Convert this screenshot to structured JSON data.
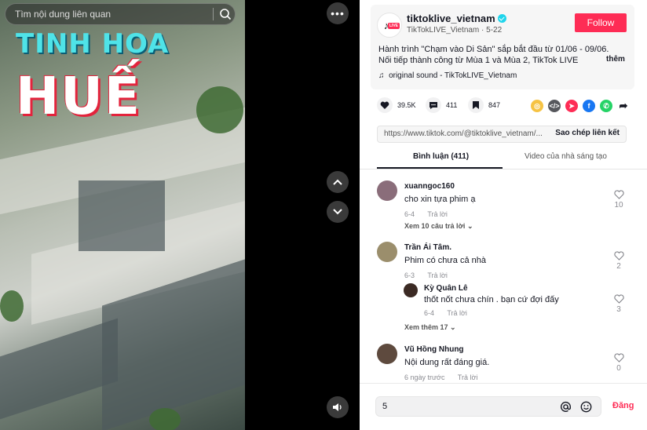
{
  "search": {
    "placeholder": "Tìm nội dung liên quan"
  },
  "video": {
    "title_line1": "TINH HOA",
    "title_line2": "HUẾ"
  },
  "author": {
    "username": "tiktoklive_vietnam",
    "subtitle": "TikTokLIVE_Vietnam · 5-22",
    "logo_badge": "LIVE",
    "follow_label": "Follow"
  },
  "post": {
    "description": "Hành trình \"Chạm vào Di Sản\" sắp bắt đầu từ 01/06 - 09/06. Nối tiếp thành công từ Mùa 1 và Mùa 2, TikTok LIVE",
    "more_label": "thêm",
    "sound": "original sound - TikTokLIVE_Vietnam"
  },
  "stats": {
    "likes": "39.5K",
    "comments": "411",
    "saves": "847"
  },
  "share_icons": [
    {
      "name": "coin-icon",
      "color": "#f6c344",
      "glyph": "◎"
    },
    {
      "name": "embed-icon",
      "color": "#56575c",
      "glyph": "</>"
    },
    {
      "name": "send-icon",
      "color": "#fe2c55",
      "glyph": "➤"
    },
    {
      "name": "facebook-icon",
      "color": "#1877f2",
      "glyph": "f"
    },
    {
      "name": "whatsapp-icon",
      "color": "#25d366",
      "glyph": "✆"
    },
    {
      "name": "forward-icon",
      "color": "#161823",
      "glyph": "➦"
    }
  ],
  "link": {
    "url": "https://www.tiktok.com/@tiktoklive_vietnam/...",
    "copy_label": "Sao chép liên kết"
  },
  "tabs": [
    {
      "label": "Bình luận (411)"
    },
    {
      "label": "Video của nhà sáng tạo"
    }
  ],
  "comments": [
    {
      "name": "xuanngoc160",
      "text": "cho xin tựa phim ạ",
      "date": "6-4",
      "reply": "Trả lời",
      "likes": "10",
      "avatar_color": "#8a6d7a"
    },
    {
      "name": "Trần Ái Tâm.",
      "text": "Phim có chưa cả nhà",
      "date": "6-3",
      "reply": "Trả lời",
      "likes": "2",
      "avatar_color": "#9b8e6c"
    },
    {
      "name": "Kỳ Quân Lê",
      "text": "thốt nốt chưa chín . bạn cứ đợi đấy",
      "date": "6-4",
      "reply": "Trả lời",
      "likes": "3",
      "avatar_color": "#3b2a24"
    },
    {
      "name": "Vũ Hồng Nhung",
      "text": "Nội dung rất đáng giá.",
      "date": "6 ngày trước",
      "reply": "Trả lời",
      "likes": "0",
      "avatar_color": "#5e4a3e"
    }
  ],
  "view_more": {
    "first": "Xem 10 câu trả lời",
    "second": "Xem thêm 17"
  },
  "comment_input": {
    "value": "5",
    "post_label": "Đăng"
  }
}
